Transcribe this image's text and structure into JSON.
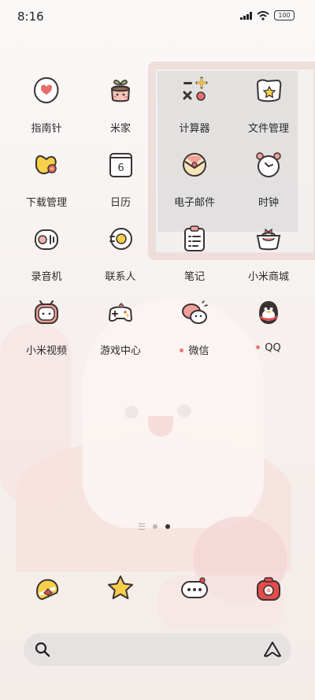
{
  "status": {
    "time": "8:16",
    "battery": "100"
  },
  "apps": [
    {
      "label": "指南针",
      "icon": "compass-icon",
      "dot": false
    },
    {
      "label": "米家",
      "icon": "mijia-icon",
      "dot": false
    },
    {
      "label": "计算器",
      "icon": "calculator-icon",
      "dot": false
    },
    {
      "label": "文件管理",
      "icon": "file-manager-icon",
      "dot": false
    },
    {
      "label": "下载管理",
      "icon": "download-manager-icon",
      "dot": false
    },
    {
      "label": "日历",
      "icon": "calendar-icon",
      "dot": false
    },
    {
      "label": "电子邮件",
      "icon": "email-icon",
      "dot": false
    },
    {
      "label": "时钟",
      "icon": "clock-icon",
      "dot": false
    },
    {
      "label": "录音机",
      "icon": "recorder-icon",
      "dot": false
    },
    {
      "label": "联系人",
      "icon": "contacts-icon",
      "dot": false
    },
    {
      "label": "笔记",
      "icon": "notes-icon",
      "dot": false
    },
    {
      "label": "小米商城",
      "icon": "mi-store-icon",
      "dot": false
    },
    {
      "label": "小米视频",
      "icon": "mi-video-icon",
      "dot": false
    },
    {
      "label": "游戏中心",
      "icon": "game-center-icon",
      "dot": false
    },
    {
      "label": "微信",
      "icon": "wechat-icon",
      "dot": true
    },
    {
      "label": "QQ",
      "icon": "qq-icon",
      "dot": true
    }
  ],
  "calendar_day": "6",
  "dock": [
    {
      "icon": "phone-icon"
    },
    {
      "icon": "gallery-icon"
    },
    {
      "icon": "messages-icon"
    },
    {
      "icon": "camera-icon"
    }
  ],
  "search": {
    "left_icon": "search-icon",
    "right_icon": "assistant-icon"
  },
  "pager": {
    "pages": 2,
    "active": 2
  },
  "colors": {
    "accent": "#e47b7b",
    "text": "#2b2b2b",
    "outline": "#3a3333"
  }
}
